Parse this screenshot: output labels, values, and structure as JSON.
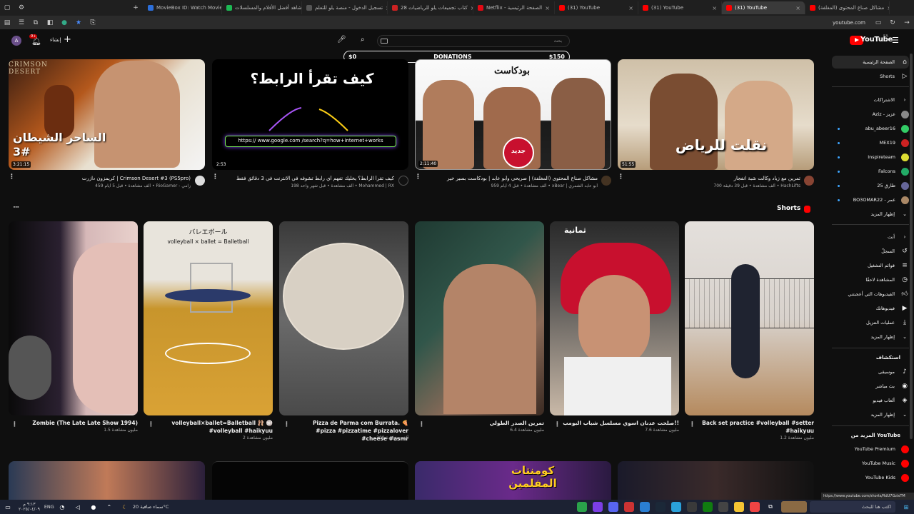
{
  "browser": {
    "tabs": [
      {
        "label": "MovieBox ID: Watch Movies, T",
        "color": "#2c6fdb"
      },
      {
        "label": "شاهد أفضل الأفلام والمسلسلات",
        "color": "#1db954"
      },
      {
        "label": "تسجيل الدخول - منصة يلو للتعلم",
        "color": "#555555"
      },
      {
        "label": "كتاب تجميعات يلو للرياضيات 28",
        "color": "#cc2222"
      },
      {
        "label": "Netflix - الصفحة الرئيسية",
        "color": "#e50914"
      },
      {
        "label": "(31) YouTube",
        "color": "#ff0000"
      },
      {
        "label": "(31) YouTube",
        "color": "#ff0000"
      },
      {
        "label": "(31) YouTube",
        "color": "#ff0000"
      },
      {
        "label": "مشاكل صناع المحتوى (المغلفة)",
        "color": "#ff0000"
      }
    ],
    "address": "youtube.com"
  },
  "header": {
    "logo_text": "YouTube",
    "logo_region": "SA",
    "create_label": "إنشاء",
    "notification_count": "9+",
    "search_placeholder": "بحث",
    "avatar_letter": "A"
  },
  "donation": {
    "left": "$0",
    "center": "DONATIONS",
    "right": "$150"
  },
  "videos": [
    {
      "duration": "3:21:15",
      "title": "كريمزون دازرت | Crimson Desert #3 (PS5pro)",
      "channel": "RioGamer - زامي",
      "meta": "459 ألف مشاهدة • قبل 5 أيام",
      "thumb_text": "الساحر الشيطان #3",
      "thumb_badge": "CRIMSON DESERT"
    },
    {
      "duration": "2:53",
      "title": "كيف تقرأ الرابط؟ يخليك تفهم أي رابط تشوفه في الانترنت في 3 دقائق فقط",
      "channel": "Mohammed | RX",
      "meta": "198 ألف مشاهدة • قبل شهر واحد",
      "thumb_text": "كيف تقرأ الرابط؟",
      "thumb_url": "https:// www.google.com /search?q=how+internet+works"
    },
    {
      "duration": "2:11:40",
      "title": "مشاكل صناع المحتوى (المغلفة) | صريحي وأبو عابد | بودكاست بسير خير",
      "channel": "xBear | أبو عابد الشمري",
      "meta": "959 ألف مشاهدة • قبل 4 أيام",
      "thumb_text": "جديد",
      "thumb_badge": "بودكاست"
    },
    {
      "duration": "51:55",
      "title": "تمرين مع زياد وكالت شبة انفجار",
      "channel": "HachLifts",
      "meta": "700 ألف مشاهدة • قبل 39 دقيقة",
      "thumb_text": "نقلت للرياض"
    }
  ],
  "shorts": {
    "heading": "Shorts",
    "items": [
      {
        "title": "Zombie (The Late Late Show 1994)",
        "views": "1.5 مليون مشاهدة"
      },
      {
        "title": "volleyball×ballet=Balletball 🩰 🏐 #volleyball #haikyuu",
        "views": "2 مليون مشاهدة",
        "thumb_text_jp": "バレエボール",
        "thumb_text_en": "volleyball × ballet = Balletball"
      },
      {
        "title": "Pizza de Parma com Burrata. 🍕 #pizza #pizzatime #pizzalover #cheese #asmr",
        "views": "309 ألف مشاهدة"
      },
      {
        "title": "تمرين الصدر الطولي",
        "views": "6.4 مليون مشاهدة"
      },
      {
        "title": "صلحت عدنان اسوي مسلسل شباب البومب!!",
        "views": "7.6 مليون مشاهدة",
        "thumb_text": "ثمانية"
      },
      {
        "title": "Back set practice #volleyball #setter #haikyuu",
        "views": "1.2 مليون مشاهدة"
      }
    ]
  },
  "bottom_row": [
    {
      "thumb_text": ""
    },
    {
      "thumb_text": ""
    },
    {
      "thumb_text": "كومنتات المفلمين"
    },
    {
      "thumb_text": ""
    }
  ],
  "sidebar": {
    "main": [
      {
        "label": "الصفحة الرئيسية",
        "icon": "home-icon"
      },
      {
        "label": "Shorts",
        "icon": "shorts-icon"
      }
    ],
    "subs_heading": "الاشتراكات",
    "subs": [
      {
        "label": "Aziz - عزيز",
        "color": "#888888"
      },
      {
        "label": "abu_abeer16",
        "color": "#33cc66"
      },
      {
        "label": "MEX19",
        "color": "#cc2222"
      },
      {
        "label": "Inspireteam",
        "color": "#dddd33"
      },
      {
        "label": "Falcons",
        "color": "#22aa66"
      },
      {
        "label": "طارق 25",
        "color": "#666699"
      },
      {
        "label": "BO3OMAR22 - عمر",
        "color": "#aa8866"
      }
    ],
    "subs_more": "إظهار المزيد",
    "you_heading": "أنت",
    "you": [
      {
        "label": "السجلّ",
        "icon": "history-icon"
      },
      {
        "label": "قوائم التشغيل",
        "icon": "playlist-icon"
      },
      {
        "label": "المشاهدة لاحقًا",
        "icon": "watch-later-icon"
      },
      {
        "label": "الفيديوهات التي أعجبتني",
        "icon": "like-icon"
      },
      {
        "label": "فيديوهاتك",
        "icon": "your-videos-icon"
      },
      {
        "label": "عمليات التنزيل",
        "icon": "download-icon"
      },
      {
        "label": "إظهار المزيد",
        "icon": "chevron-down-icon"
      }
    ],
    "explore_heading": "استكشاف",
    "explore": [
      {
        "label": "موسيقى",
        "icon": "music-icon"
      },
      {
        "label": "بث مباشر",
        "icon": "live-icon"
      },
      {
        "label": "ألعاب فيديو",
        "icon": "gaming-icon"
      },
      {
        "label": "إظهار المزيد",
        "icon": "chevron-down-icon"
      }
    ],
    "more_heading": "المزيد من YouTube",
    "more": [
      {
        "label": "YouTube Premium"
      },
      {
        "label": "YouTube Music"
      },
      {
        "label": "YouTube Kids"
      }
    ]
  },
  "status_url": "https://www.youtube.com/shorts/RdU7GzixTM",
  "taskbar": {
    "weather": "سماء صافية 20°C",
    "lang": "ENG",
    "time": "٩:١٣ م",
    "date": "٢٠٢٥/٠٤/٠٩",
    "search_placeholder": "اكتب هنا للبحث"
  },
  "colors": {
    "accent": "#ff0000",
    "bg": "#0f0f0f",
    "link": "#3ea6ff"
  }
}
